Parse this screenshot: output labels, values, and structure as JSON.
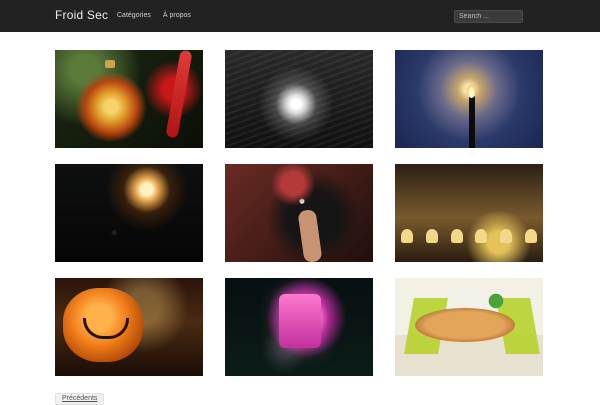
{
  "header": {
    "site_title": "Froid Sec",
    "nav": [
      {
        "label": "Catégories"
      },
      {
        "label": "À propos"
      }
    ],
    "search": {
      "placeholder": "Search ..."
    }
  },
  "gallery": {
    "items": [
      {
        "subject": "christmas ornament"
      },
      {
        "subject": "street light in snow"
      },
      {
        "subject": "candle flame"
      },
      {
        "subject": "night light"
      },
      {
        "subject": "person with face paint"
      },
      {
        "subject": "paper ghost garland"
      },
      {
        "subject": "carved pumpkin"
      },
      {
        "subject": "pink lantern"
      },
      {
        "subject": "table and chairs"
      }
    ]
  },
  "pagination": {
    "older_label": "Précédents"
  },
  "colors": {
    "topbar_bg": "#222222",
    "page_bg": "#ffffff",
    "link_text": "#cfcfcf"
  }
}
